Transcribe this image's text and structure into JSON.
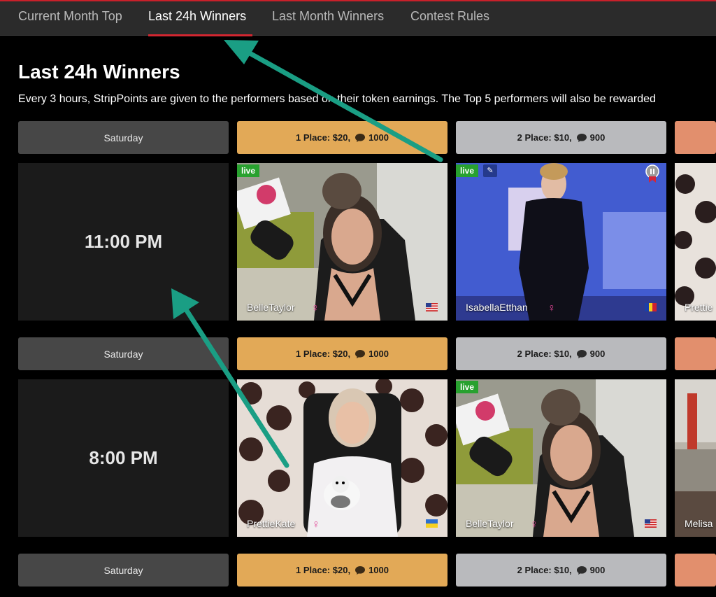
{
  "tabs": [
    {
      "label": "Current Month Top"
    },
    {
      "label": "Last 24h Winners"
    },
    {
      "label": "Last Month Winners"
    },
    {
      "label": "Contest Rules"
    }
  ],
  "page": {
    "title": "Last 24h Winners",
    "description": "Every 3 hours, StripPoints are given to the performers based on their token earnings. The Top 5 performers will also be rewarded"
  },
  "rows": [
    {
      "day": "Saturday",
      "time": "11:00 PM",
      "place1": {
        "label": "1 Place: $20,",
        "points": "1000"
      },
      "place2": {
        "label": "2 Place: $10,",
        "points": "900"
      },
      "performers": [
        {
          "name": "BelleTaylor",
          "live": "live"
        },
        {
          "name": "IsabellaEtthan",
          "live": "live"
        },
        {
          "name": "Prettie"
        }
      ]
    },
    {
      "day": "Saturday",
      "time": "8:00 PM",
      "place1": {
        "label": "1 Place: $20,",
        "points": "1000"
      },
      "place2": {
        "label": "2 Place: $10,",
        "points": "900"
      },
      "performers": [
        {
          "name": "PrettieKate"
        },
        {
          "name": "BelleTaylor",
          "live": "live"
        },
        {
          "name": "Melisa"
        }
      ]
    },
    {
      "day": "Saturday",
      "place1": {
        "label": "1 Place: $20,",
        "points": "1000"
      },
      "place2": {
        "label": "2 Place: $10,",
        "points": "900"
      }
    }
  ],
  "colors": {
    "accent": "#d22630",
    "gold": "#e2a957",
    "silver": "#b9babd",
    "bronze": "#e28f6d",
    "live_badge": "#28a12f",
    "annotation_arrow": "#1a9e84"
  },
  "icons": [
    "token-icon",
    "female-icon",
    "us-flag-icon",
    "romania-flag-icon",
    "ukraine-flag-icon",
    "hd-icon",
    "award-pin-icon"
  ]
}
